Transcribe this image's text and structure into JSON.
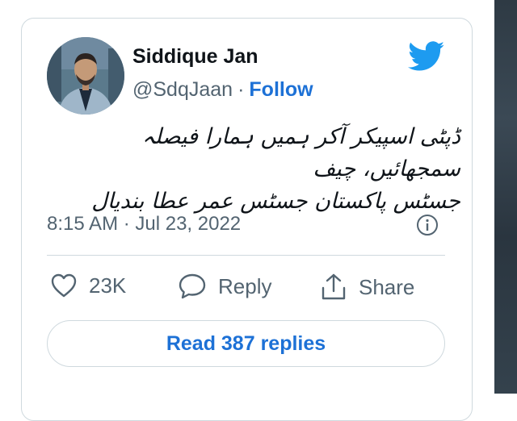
{
  "tweet": {
    "author_name": "Siddique Jan",
    "author_handle": "@SdqJaan",
    "separator": "·",
    "follow_label": "Follow",
    "text_line_1": "ڈپٹی اسپیکر آکر ہمیں ہمارا فیصلہ سمجھائیں، چیف",
    "text_line_2": "جسٹس پاکستان جسٹس عمر عطا بندیال",
    "timestamp": "8:15 AM · Jul 23, 2022",
    "likes_count": "23K",
    "reply_label": "Reply",
    "share_label": "Share",
    "read_replies_label": "Read 387 replies"
  },
  "icons": {
    "brand": "twitter-bird-icon",
    "info": "info-icon",
    "like": "heart-icon",
    "reply": "speech-bubble-icon",
    "share": "share-icon"
  },
  "colors": {
    "brand_blue": "#1d9bf0",
    "link_blue": "#1d71d6",
    "text_primary": "#0f1419",
    "text_secondary": "#536471",
    "border": "#cfd9de"
  }
}
